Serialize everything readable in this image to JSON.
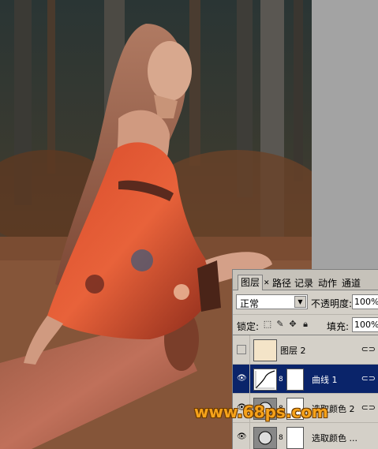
{
  "panel": {
    "tabs": [
      {
        "label": "图层",
        "active": true
      },
      {
        "label": "路径",
        "active": false
      },
      {
        "label": "记录",
        "active": false
      },
      {
        "label": "动作",
        "active": false
      },
      {
        "label": "通道",
        "active": false
      }
    ],
    "blend_mode": "正常",
    "opacity_label": "不透明度:",
    "opacity_value": "100%",
    "lock_label": "锁定:",
    "fill_label": "填充:",
    "fill_value": "100%",
    "layers": [
      {
        "name": "图层 2",
        "visible": false,
        "selected": false,
        "thumb": "pattern",
        "has_mask": false
      },
      {
        "name": "曲线 1",
        "visible": true,
        "selected": true,
        "thumb": "curves-icon",
        "has_mask": true
      },
      {
        "name": "选取颜色 2",
        "visible": true,
        "selected": false,
        "thumb": "selective-color-icon",
        "has_mask": true
      },
      {
        "name": "选取颜色 ...",
        "visible": true,
        "selected": false,
        "thumb": "selective-color-icon",
        "has_mask": true
      }
    ]
  },
  "watermark": "www.68ps.com",
  "colors": {
    "selected_layer": "#0a246a",
    "panel_bg": "#d4d0c8",
    "watermark": "#f6a21a"
  }
}
